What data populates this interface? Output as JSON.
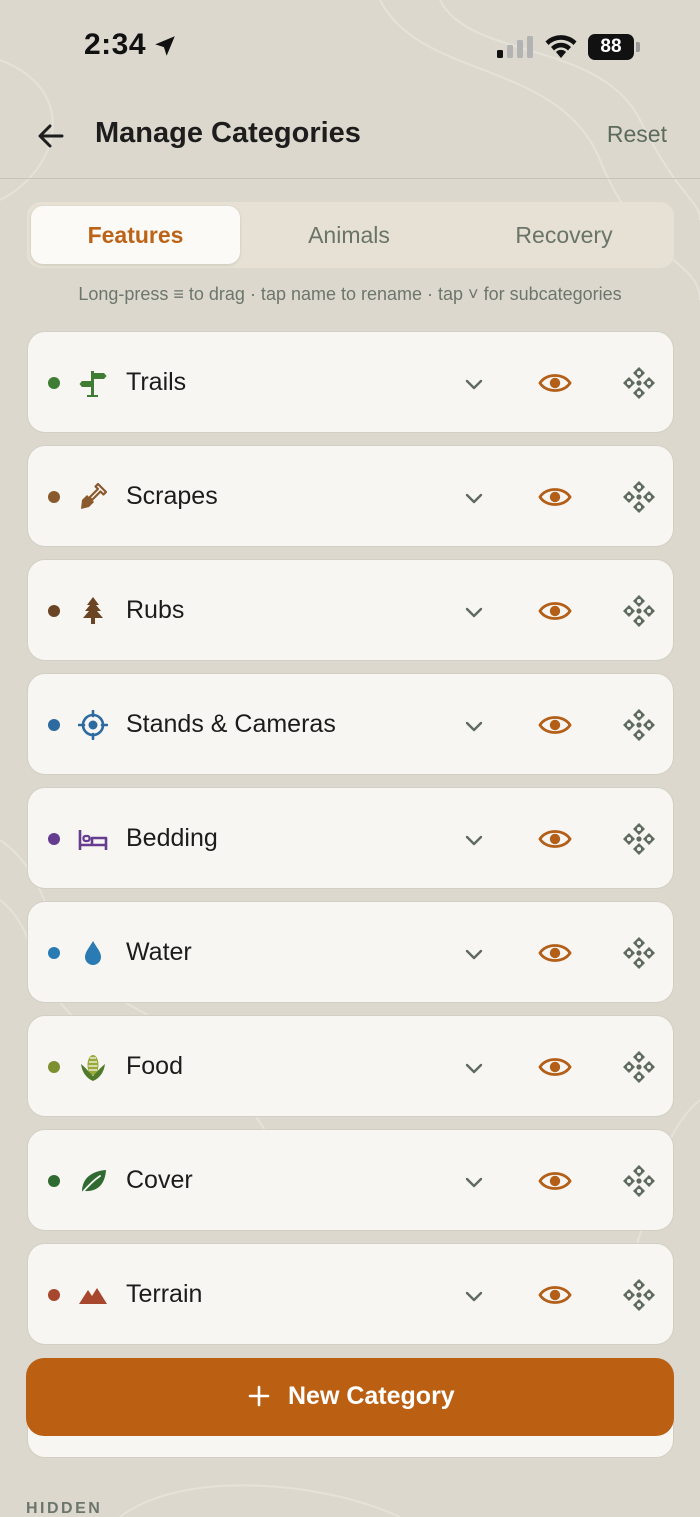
{
  "status_bar": {
    "time": "2:34",
    "battery": "88"
  },
  "header": {
    "title": "Manage Categories",
    "reset_label": "Reset"
  },
  "tabs": [
    {
      "label": "Features",
      "active": true
    },
    {
      "label": "Animals",
      "active": false
    },
    {
      "label": "Recovery",
      "active": false
    }
  ],
  "hint": "Long-press ≡ to drag · tap name to rename · tap ˅ for subcategories",
  "categories": [
    {
      "name": "Trails",
      "dot_color": "#3f7d35",
      "icon": "signpost-icon",
      "icon_color": "#3f7d35",
      "visible": true
    },
    {
      "name": "Scrapes",
      "dot_color": "#8a5a2f",
      "icon": "shovel-icon",
      "icon_color": "#8a5a2f",
      "visible": true
    },
    {
      "name": "Rubs",
      "dot_color": "#6b4424",
      "icon": "tree-icon",
      "icon_color": "#6b4424",
      "visible": true
    },
    {
      "name": "Stands & Cameras",
      "dot_color": "#2d6a9f",
      "icon": "crosshair-icon",
      "icon_color": "#2d6a9f",
      "visible": true
    },
    {
      "name": "Bedding",
      "dot_color": "#653c8f",
      "icon": "bed-icon",
      "icon_color": "#653c8f",
      "visible": true
    },
    {
      "name": "Water",
      "dot_color": "#2a7bb3",
      "icon": "water-drop-icon",
      "icon_color": "#2a7bb3",
      "visible": true
    },
    {
      "name": "Food",
      "dot_color": "#7d9030",
      "icon": "corn-icon",
      "icon_color": "#7d9030",
      "visible": true
    },
    {
      "name": "Cover",
      "dot_color": "#2f6a30",
      "icon": "leaf-icon",
      "icon_color": "#2f6a30",
      "visible": true
    },
    {
      "name": "Terrain",
      "dot_color": "#a6472e",
      "icon": "mountain-icon",
      "icon_color": "#a6472e",
      "visible": true
    }
  ],
  "new_category_label": "New Category",
  "hidden_section_label": "HIDDEN",
  "colors": {
    "accent": "#bb5f13",
    "background": "#dcd8ce",
    "row_background": "#f7f6f3",
    "eye_icon": "#b35f18",
    "drag_icon": "#5e6b5e",
    "muted_text": "#6a7469"
  }
}
